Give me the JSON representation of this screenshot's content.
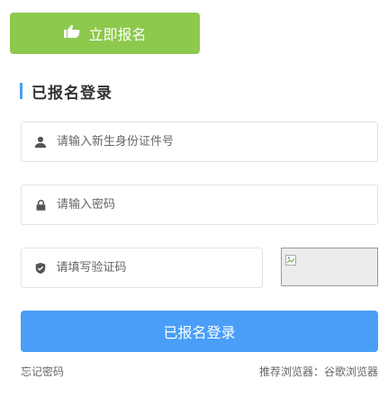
{
  "register_button": {
    "label": "立即报名",
    "icon": "hand-pointing-icon"
  },
  "section": {
    "title": "已报名登录"
  },
  "fields": {
    "id_number": {
      "placeholder": "请输入新生身份证件号",
      "value": "",
      "icon": "user-icon"
    },
    "password": {
      "placeholder": "请输入密码",
      "value": "",
      "icon": "lock-icon"
    },
    "captcha": {
      "placeholder": "请填写验证码",
      "value": "",
      "icon": "shield-icon"
    }
  },
  "login_button": {
    "label": "已报名登录"
  },
  "footer": {
    "forgot_password": "忘记密码",
    "recommended_label": "推荐浏览器：",
    "recommended_browser": "谷歌浏览器"
  },
  "colors": {
    "green": "#8dc94c",
    "blue": "#4a9ef8",
    "text": "#333333"
  }
}
